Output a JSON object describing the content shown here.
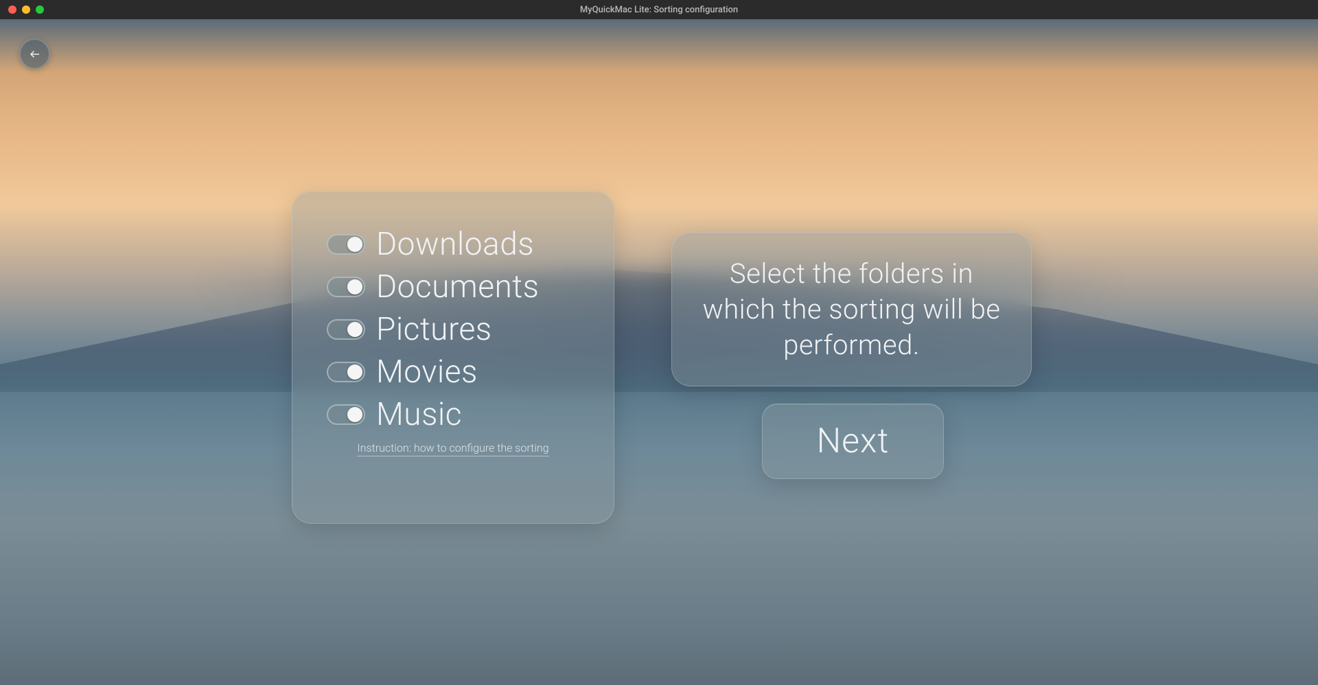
{
  "titlebar": {
    "title": "MyQuickMac Lite: Sorting configuration"
  },
  "folders": {
    "items": [
      {
        "label": "Downloads",
        "enabled": true
      },
      {
        "label": "Documents",
        "enabled": true
      },
      {
        "label": "Pictures",
        "enabled": true
      },
      {
        "label": "Movies",
        "enabled": true
      },
      {
        "label": "Music",
        "enabled": true
      }
    ],
    "instruction_link": "Instruction: how to configure the sorting"
  },
  "message": {
    "text": "Select the folders in which the sorting will be performed."
  },
  "actions": {
    "next_label": "Next"
  }
}
